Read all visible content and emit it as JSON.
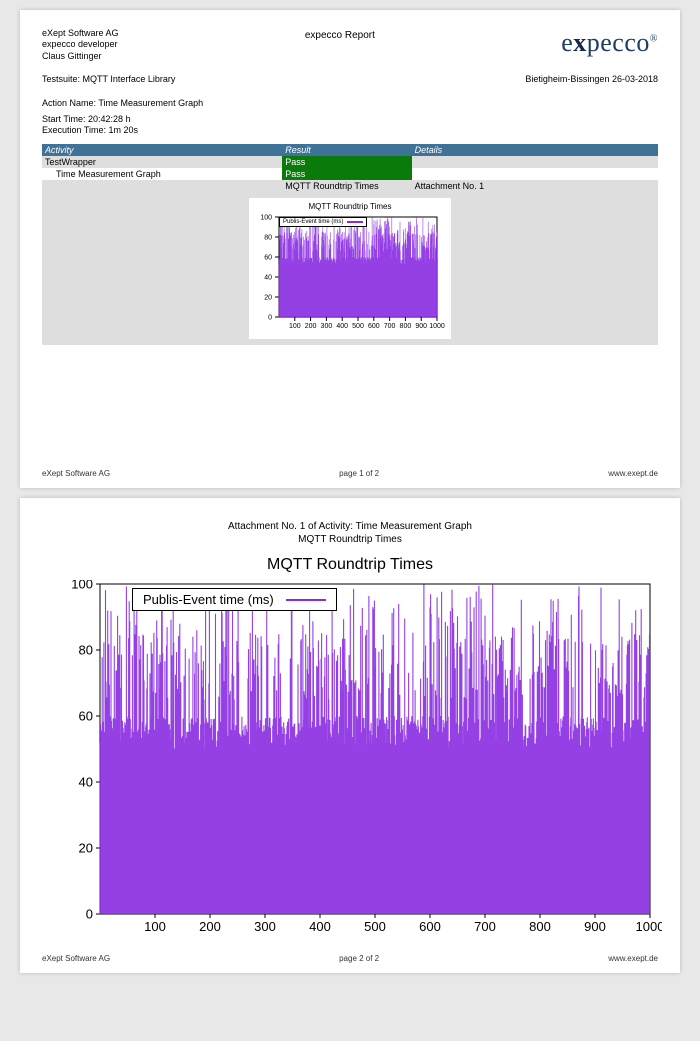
{
  "header": {
    "company": "eXept Software AG",
    "product": "expecco developer",
    "author": "Claus Gittinger",
    "report_title": "expecco Report",
    "logo_text": "expecco",
    "location_date": "Bietigheim-Bissingen 26-03-2018"
  },
  "suite": {
    "label": "Testsuite:",
    "name": "MQTT Interface Library"
  },
  "action": {
    "label": "Action Name:",
    "name": "Time Measurement Graph"
  },
  "times": {
    "start_label": "Start Time:",
    "start": "20:42:28 h",
    "exec_label": "Execution Time:",
    "exec": "1m 20s"
  },
  "table": {
    "headers": {
      "activity": "Activity",
      "result": "Result",
      "details": "Details"
    },
    "rows": [
      {
        "activity": "TestWrapper",
        "result": "Pass",
        "details": "",
        "indent": 0,
        "alt": true
      },
      {
        "activity": "Time Measurement Graph",
        "result": "Pass",
        "details": "",
        "indent": 1,
        "alt": false
      },
      {
        "activity": "",
        "result": "MQTT Roundtrip Times",
        "details": "Attachment No. 1",
        "indent": 1,
        "alt": true,
        "result_plain": true
      }
    ]
  },
  "chart_small": {
    "title": "MQTT Roundtrip Times",
    "legend": "Publis-Event time (ms)"
  },
  "chart_data": {
    "type": "line",
    "title": "MQTT Roundtrip Times",
    "legend": "Publis-Event time (ms)",
    "xlabel": "",
    "ylabel": "",
    "xlim": [
      0,
      1000
    ],
    "ylim": [
      0,
      100
    ],
    "xticks": [
      100,
      200,
      300,
      400,
      500,
      600,
      700,
      800,
      900,
      1000
    ],
    "yticks": [
      0,
      20,
      40,
      60,
      80,
      100
    ],
    "n_points": 1000,
    "baseline_approx": 55,
    "mean_approx": 62,
    "typical_peak_range": [
      60,
      100
    ],
    "color": "#8a2be2",
    "note": "dense noisy series; individual sample values not readable, peaks reach 90-100 sporadically"
  },
  "page2": {
    "caption1": "Attachment No. 1 of Activity: Time Measurement Graph",
    "caption2": "MQTT Roundtrip Times"
  },
  "footer": {
    "left": "eXept Software AG",
    "p1": "page 1 of 2",
    "p2": "page 2 of 2",
    "right": "www.exept.de"
  }
}
